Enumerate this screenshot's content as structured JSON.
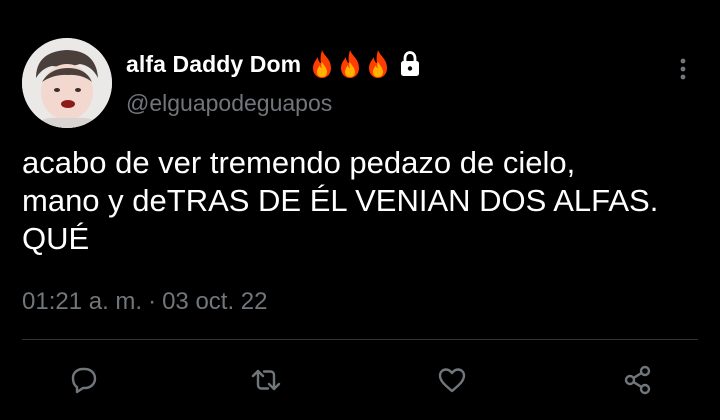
{
  "colors": {
    "background": "#000000",
    "text_primary": "#ffffff",
    "text_secondary": "#71767b",
    "divider": "#2f3336",
    "flame": "#ff5722"
  },
  "author": {
    "display_name": "alfa Daddy Dom",
    "handle": "@elguapodeguapos",
    "name_emojis": [
      "fire-emoji",
      "fire-emoji",
      "fire-emoji"
    ],
    "protected_icon": "lock-icon",
    "avatar": "avatar-photo"
  },
  "tweet": {
    "text": "acabo de ver tremendo pedazo de cielo,\nmano y deTRAS DE ÉL VENIAN DOS ALFAS.\nQUÉ",
    "time": "01:21 a. m.",
    "separator": "·",
    "date": "03 oct. 22"
  },
  "actions": {
    "more": "more-vertical-icon",
    "items": [
      "reply-icon",
      "retweet-icon",
      "like-icon",
      "share-icon"
    ]
  }
}
